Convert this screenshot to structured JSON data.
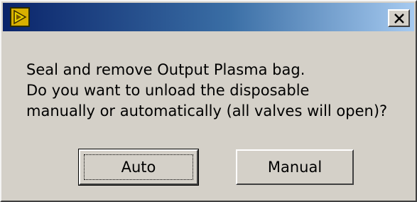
{
  "window": {
    "title": "",
    "icon": "labview-run-arrow-icon",
    "close_glyph": "close-icon"
  },
  "message": {
    "lines": [
      "Seal and remove Output Plasma bag.",
      "Do you want  to unload the disposable",
      "manually or automatically (all valves will open)?"
    ]
  },
  "buttons": {
    "auto_label": "Auto",
    "manual_label": "Manual"
  },
  "colors": {
    "title_gradient_start": "#0a246a",
    "title_gradient_end": "#a6caf0",
    "dialog_face": "#d4d0c8"
  }
}
